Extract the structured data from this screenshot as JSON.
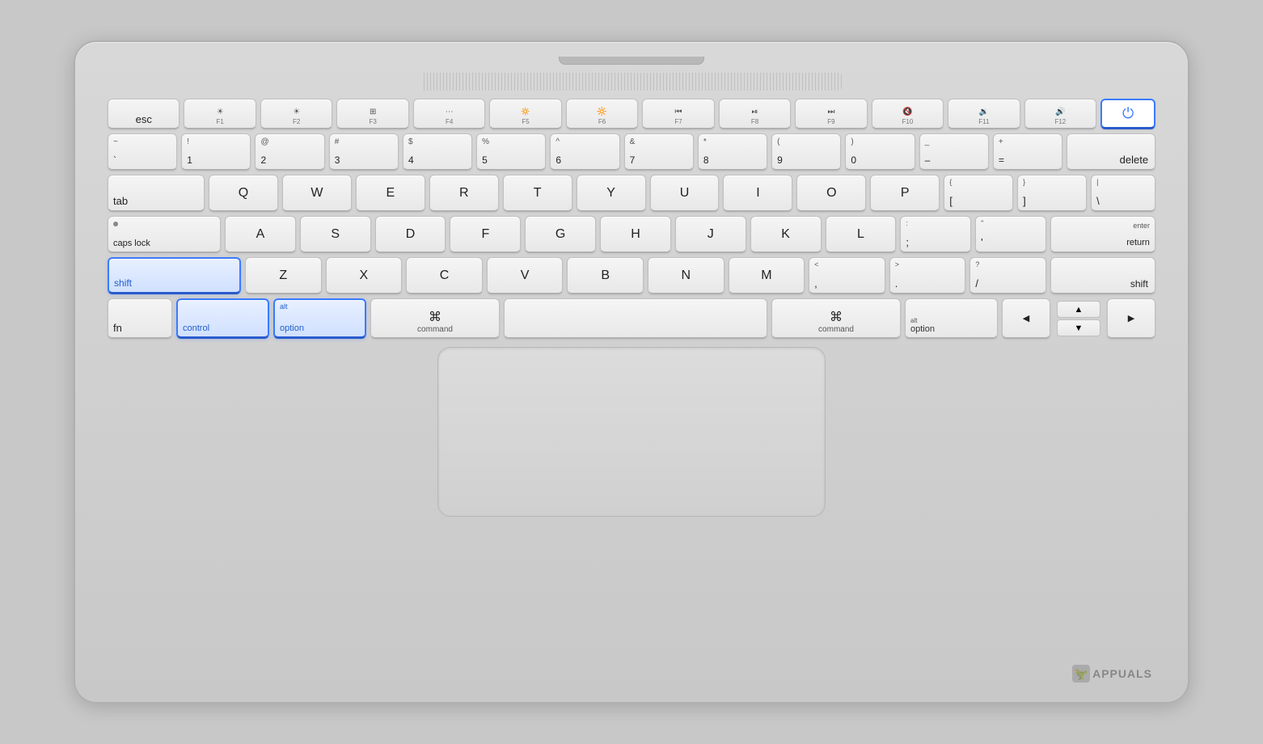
{
  "keyboard": {
    "rows": {
      "fn_row": {
        "esc": "esc",
        "power_label": "⏻"
      },
      "num_row": {
        "keys": [
          {
            "top": "~",
            "main": "`"
          },
          {
            "top": "!",
            "main": "1"
          },
          {
            "top": "@",
            "main": "2"
          },
          {
            "top": "#",
            "main": "3"
          },
          {
            "top": "$",
            "main": "4"
          },
          {
            "top": "%",
            "main": "5"
          },
          {
            "top": "^",
            "main": "6"
          },
          {
            "top": "&",
            "main": "7"
          },
          {
            "top": "*",
            "main": "8"
          },
          {
            "top": "(",
            "main": "9"
          },
          {
            "top": ")",
            "main": "0"
          },
          {
            "top": "_",
            "main": "–"
          },
          {
            "top": "+",
            "main": "="
          },
          {
            "top": "",
            "main": "delete"
          }
        ]
      },
      "qwerty": {
        "tab": "tab",
        "letters": [
          "Q",
          "W",
          "E",
          "R",
          "T",
          "Y",
          "U",
          "I",
          "O",
          "P"
        ],
        "brackets": [
          "{  [",
          "}  ]"
        ],
        "pipe": "|  \\"
      },
      "asdf": {
        "caps": "caps lock",
        "letters": [
          "A",
          "S",
          "D",
          "F",
          "G",
          "H",
          "J",
          "K",
          "L"
        ],
        "semicolon": ";  :",
        "quote": "\"  '",
        "enter_top": "enter",
        "enter_bottom": "return"
      },
      "zxcv": {
        "shift_left": "shift",
        "letters": [
          "Z",
          "X",
          "C",
          "V",
          "B",
          "N",
          "M"
        ],
        "lt": "<  ,",
        "gt": ">  .",
        "question": "?  /",
        "shift_right": "shift"
      },
      "bottom": {
        "fn": "fn",
        "control": "control",
        "option_left_top": "alt",
        "option_left": "option",
        "command_left_symbol": "⌘",
        "command_left": "command",
        "command_right_symbol": "⌘",
        "command_right": "command",
        "option_right_top": "alt",
        "option_right": "option",
        "arrow_left": "◀",
        "arrow_up": "▲",
        "arrow_down": "▼",
        "arrow_right": "▶"
      }
    }
  },
  "watermark": {
    "icon": "🦖",
    "text": "appuals"
  }
}
